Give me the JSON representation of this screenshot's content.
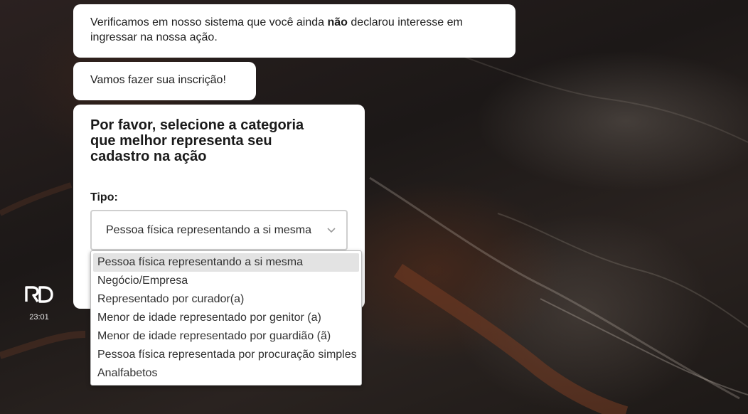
{
  "messages": {
    "msg1_before": "Verificamos em nosso sistema que você ainda ",
    "msg1_bold": "não",
    "msg1_after": " declarou interesse em ingressar na nossa ação.",
    "msg2": "Vamos fazer sua inscrição!"
  },
  "form": {
    "question": "Por favor, selecione a categoria que melhor representa seu cadastro na ação",
    "type_label": "Tipo:",
    "selected_value": "Pessoa física representando a si mesma",
    "options": [
      "Pessoa física representando a si mesma",
      "Negócio/Empresa",
      "Representado por curador(a)",
      "Menor de idade representado por genitor (a)",
      "Menor de idade representado por guardião (ã)",
      "Pessoa física representada por procuração simples",
      "Analfabetos"
    ]
  },
  "bot": {
    "logo_icon": "rd-logo-icon",
    "timestamp": "23:01"
  },
  "icons": {
    "select": "chevron-down-icon"
  },
  "colors": {
    "bubble": "#ffffff",
    "text": "#1d1d1d",
    "selected_option": "#e3e3e3",
    "background": "#1e1a18"
  }
}
